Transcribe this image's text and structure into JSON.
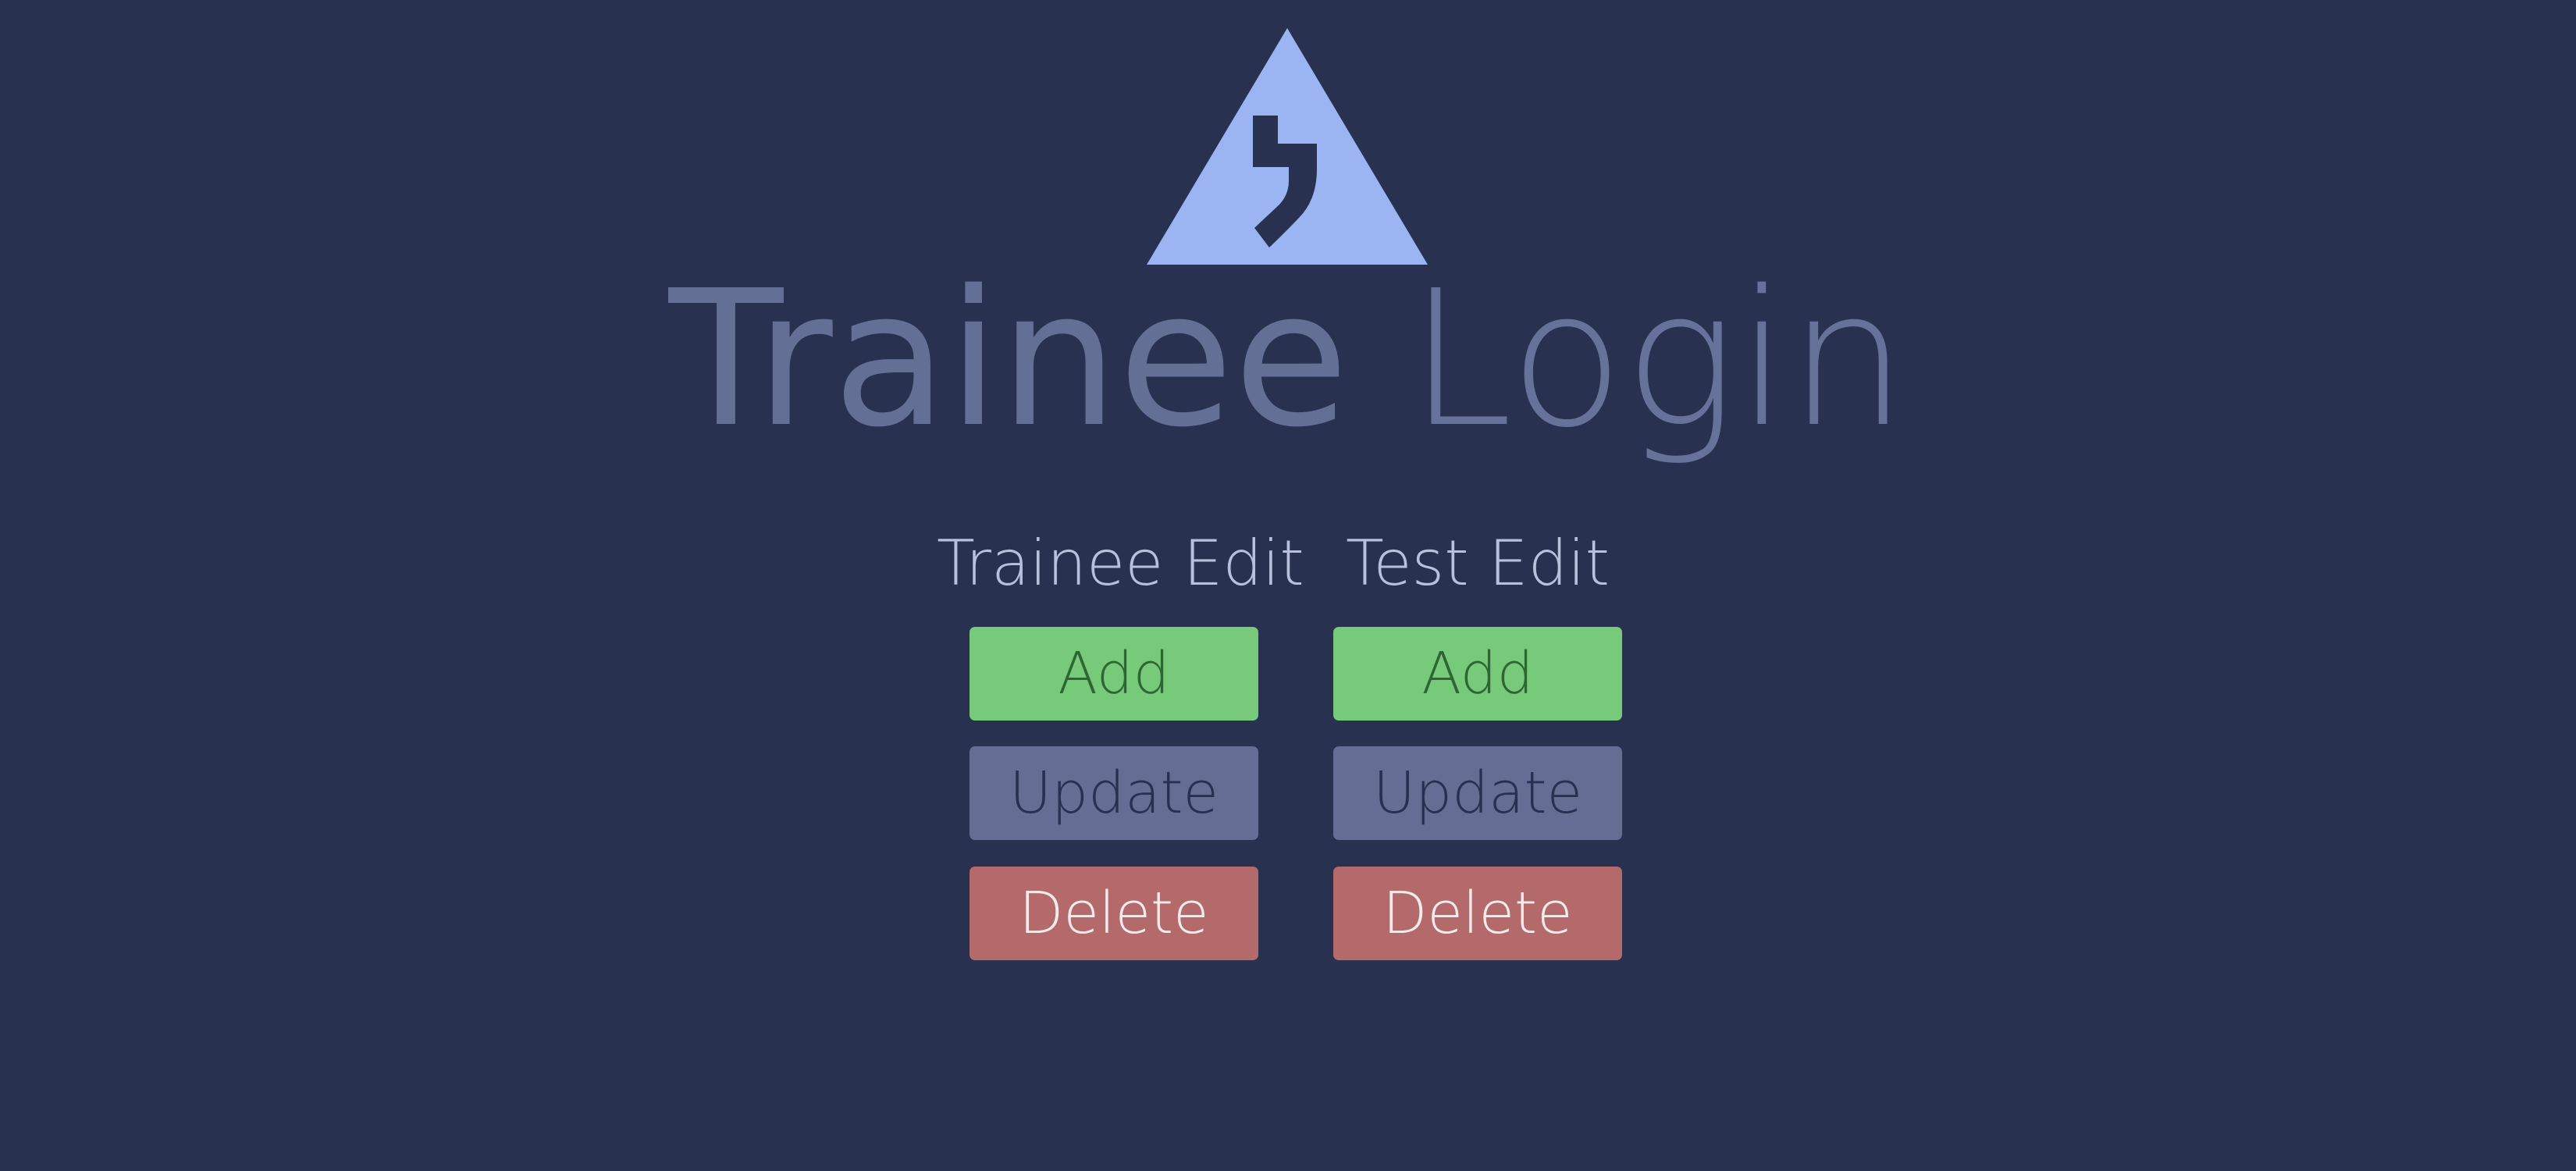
{
  "header": {
    "logo_icon": "triangle-logo-icon",
    "title_part1": "Trainee",
    "title_part2": "Login"
  },
  "trainee_edit": {
    "heading": "Trainee Edit",
    "add_label": "Add",
    "update_label": "Update",
    "delete_label": "Delete"
  },
  "test_edit": {
    "heading": "Test Edit",
    "add_label": "Add",
    "update_label": "Update",
    "delete_label": "Delete"
  },
  "colors": {
    "background": "#283150",
    "logo": "#9bb4f2",
    "title": "#636f95",
    "add": "#76ca7a",
    "update": "#646e94",
    "delete": "#b46a6b"
  }
}
